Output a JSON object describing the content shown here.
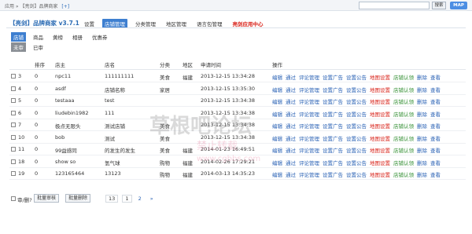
{
  "top": {
    "breadcrumb": "应用 » 【亮剑】品牌商家",
    "add_link": "[+]",
    "search_button": "搜索",
    "map_button": "MAP"
  },
  "app": {
    "title": "【亮剑】品牌商家 v3.7.1"
  },
  "nav": [
    {
      "label": "设置",
      "active": false
    },
    {
      "label": "店铺管理",
      "active": true
    },
    {
      "label": "分类管理",
      "active": false
    },
    {
      "label": "地区管理",
      "active": false
    },
    {
      "label": "语言包管理",
      "active": false
    },
    {
      "label": "亮剑应用中心",
      "active": false,
      "red": true
    }
  ],
  "subnav": [
    {
      "label": "店铺",
      "active": true
    },
    {
      "label": "商品",
      "active": false
    },
    {
      "label": "黄榜",
      "active": false
    },
    {
      "label": "相册",
      "active": false
    },
    {
      "label": "优惠券",
      "active": false
    }
  ],
  "subnav2": [
    {
      "label": "未审",
      "active": true
    },
    {
      "label": "已审",
      "active": false
    }
  ],
  "table": {
    "headers": [
      "排序",
      "店主",
      "店名",
      "分类",
      "地区",
      "申请时间",
      "操作"
    ],
    "rows": [
      {
        "id": "3",
        "sort": "0",
        "owner": "npc11",
        "name": "111111111",
        "category": "美食",
        "region": "福建",
        "time": "2013-12-15 13:34:28"
      },
      {
        "id": "4",
        "sort": "0",
        "owner": "asdf",
        "name": "店铺名称",
        "category": "家居",
        "region": "",
        "time": "2013-12-15 13:35:30"
      },
      {
        "id": "5",
        "sort": "0",
        "owner": "testaaa",
        "name": "test",
        "category": "",
        "region": "",
        "time": "2013-12-15 13:34:38"
      },
      {
        "id": "6",
        "sort": "0",
        "owner": "liudebin1982",
        "name": "111",
        "category": "",
        "region": "",
        "time": "2013-12-15 13:34:38"
      },
      {
        "id": "7",
        "sort": "0",
        "owner": "极点无限头",
        "name": "测试店铺",
        "category": "美食",
        "region": "",
        "time": "2013-12-15 13:34:38"
      },
      {
        "id": "10",
        "sort": "0",
        "owner": "bob",
        "name": "测试",
        "category": "美食",
        "region": "",
        "time": "2013-12-15 13:34:38"
      },
      {
        "id": "11",
        "sort": "0",
        "owner": "99益感同",
        "name": "的发生的发生",
        "category": "美食",
        "region": "福建",
        "time": "2014-01-23 16:49:51"
      },
      {
        "id": "18",
        "sort": "0",
        "owner": "show so",
        "name": "氢气球",
        "category": "购物",
        "region": "福建",
        "time": "2014-02-26 17:29:21"
      },
      {
        "id": "19",
        "sort": "0",
        "owner": "123165464",
        "name": "13123",
        "category": "购物",
        "region": "福建",
        "time": "2014-03-13 14:35:23"
      }
    ],
    "actions": [
      {
        "label": "编辑",
        "color": "blue"
      },
      {
        "label": "通过",
        "color": "blue"
      },
      {
        "label": "评论管理",
        "color": "blue"
      },
      {
        "label": "设置广告",
        "color": "blue"
      },
      {
        "label": "设置公告",
        "color": "blue"
      },
      {
        "label": "地图设置",
        "color": "red"
      },
      {
        "label": "店铺认领",
        "color": "green"
      },
      {
        "label": "删除",
        "color": "blue"
      },
      {
        "label": "查看",
        "color": "blue"
      }
    ]
  },
  "footer": {
    "select_all": "审/删?",
    "batch_approve": "批量审核",
    "batch_delete": "批量删除",
    "pager_total": "13",
    "pages": [
      "1",
      "2",
      "»"
    ]
  },
  "watermark": {
    "text": "草根吧论坛",
    "subtext": "禁止转载",
    "url": "www.cgbbs.com"
  }
}
